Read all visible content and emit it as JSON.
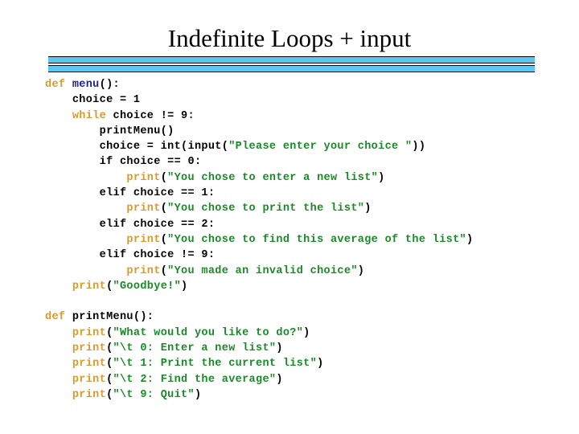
{
  "slide": {
    "title": "Indefinite Loops + input",
    "divider": {
      "bar_color": "#5BC8F0",
      "border_color": "#000000",
      "bar_count": 2
    }
  },
  "colors": {
    "keyword": "#D99A2E",
    "function_name": "#2020A0",
    "string": "#1A8A28",
    "plain": "#000000",
    "background": "#FFFFFF",
    "accent_bar": "#5BC8F0"
  },
  "code": {
    "language": "python",
    "lines": [
      {
        "indent": 0,
        "tokens": [
          {
            "t": "def ",
            "c": "kw"
          },
          {
            "t": "menu",
            "c": "fn"
          },
          {
            "t": "():",
            "c": "plain"
          }
        ]
      },
      {
        "indent": 1,
        "tokens": [
          {
            "t": "choice = 1",
            "c": "plain"
          }
        ]
      },
      {
        "indent": 1,
        "tokens": [
          {
            "t": "while ",
            "c": "kw"
          },
          {
            "t": "choice != 9:",
            "c": "plain"
          }
        ]
      },
      {
        "indent": 2,
        "tokens": [
          {
            "t": "printMenu()",
            "c": "plain"
          }
        ]
      },
      {
        "indent": 2,
        "tokens": [
          {
            "t": "choice = int(input(",
            "c": "plain"
          },
          {
            "t": "\"Please enter your choice \"",
            "c": "str"
          },
          {
            "t": "))",
            "c": "plain"
          }
        ]
      },
      {
        "indent": 2,
        "tokens": [
          {
            "t": "if choice == 0:",
            "c": "plain"
          }
        ]
      },
      {
        "indent": 3,
        "tokens": [
          {
            "t": "print",
            "c": "kw"
          },
          {
            "t": "(",
            "c": "plain"
          },
          {
            "t": "\"You chose to enter a new list\"",
            "c": "str"
          },
          {
            "t": ")",
            "c": "plain"
          }
        ]
      },
      {
        "indent": 2,
        "tokens": [
          {
            "t": "elif choice == 1:",
            "c": "plain"
          }
        ]
      },
      {
        "indent": 3,
        "tokens": [
          {
            "t": "print",
            "c": "kw"
          },
          {
            "t": "(",
            "c": "plain"
          },
          {
            "t": "\"You chose to print the list\"",
            "c": "str"
          },
          {
            "t": ")",
            "c": "plain"
          }
        ]
      },
      {
        "indent": 2,
        "tokens": [
          {
            "t": "elif choice == 2:",
            "c": "plain"
          }
        ]
      },
      {
        "indent": 3,
        "tokens": [
          {
            "t": "print",
            "c": "kw"
          },
          {
            "t": "(",
            "c": "plain"
          },
          {
            "t": "\"You chose to find this average of the list\"",
            "c": "str"
          },
          {
            "t": ")",
            "c": "plain"
          }
        ]
      },
      {
        "indent": 2,
        "tokens": [
          {
            "t": "elif choice != 9:",
            "c": "plain"
          }
        ]
      },
      {
        "indent": 3,
        "tokens": [
          {
            "t": "print",
            "c": "kw"
          },
          {
            "t": "(",
            "c": "plain"
          },
          {
            "t": "\"You made an invalid choice\"",
            "c": "str"
          },
          {
            "t": ")",
            "c": "plain"
          }
        ]
      },
      {
        "indent": 1,
        "tokens": [
          {
            "t": "print",
            "c": "kw"
          },
          {
            "t": "(",
            "c": "plain"
          },
          {
            "t": "\"Goodbye!\"",
            "c": "str"
          },
          {
            "t": ")",
            "c": "plain"
          }
        ]
      },
      {
        "indent": 0,
        "tokens": []
      },
      {
        "indent": 0,
        "tokens": [
          {
            "t": "def ",
            "c": "kw"
          },
          {
            "t": "printMenu():",
            "c": "plain"
          }
        ]
      },
      {
        "indent": 1,
        "tokens": [
          {
            "t": "print",
            "c": "kw"
          },
          {
            "t": "(",
            "c": "plain"
          },
          {
            "t": "\"What would you like to do?\"",
            "c": "str"
          },
          {
            "t": ")",
            "c": "plain"
          }
        ]
      },
      {
        "indent": 1,
        "tokens": [
          {
            "t": "print",
            "c": "kw"
          },
          {
            "t": "(",
            "c": "plain"
          },
          {
            "t": "\"\\t 0: Enter a new list\"",
            "c": "str"
          },
          {
            "t": ")",
            "c": "plain"
          }
        ]
      },
      {
        "indent": 1,
        "tokens": [
          {
            "t": "print",
            "c": "kw"
          },
          {
            "t": "(",
            "c": "plain"
          },
          {
            "t": "\"\\t 1: Print the current list\"",
            "c": "str"
          },
          {
            "t": ")",
            "c": "plain"
          }
        ]
      },
      {
        "indent": 1,
        "tokens": [
          {
            "t": "print",
            "c": "kw"
          },
          {
            "t": "(",
            "c": "plain"
          },
          {
            "t": "\"\\t 2: Find the average\"",
            "c": "str"
          },
          {
            "t": ")",
            "c": "plain"
          }
        ]
      },
      {
        "indent": 1,
        "tokens": [
          {
            "t": "print",
            "c": "kw"
          },
          {
            "t": "(",
            "c": "plain"
          },
          {
            "t": "\"\\t 9: Quit\"",
            "c": "str"
          },
          {
            "t": ")",
            "c": "plain"
          }
        ]
      }
    ]
  }
}
